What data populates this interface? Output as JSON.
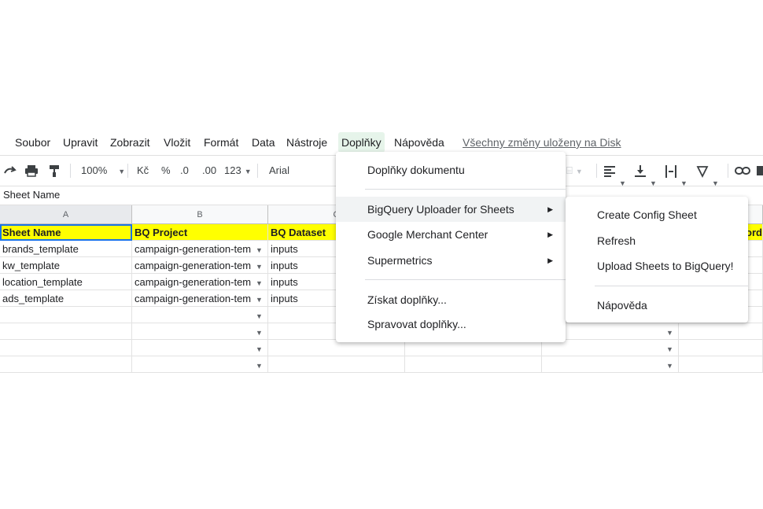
{
  "menubar": {
    "items": [
      "Soubor",
      "Upravit",
      "Zobrazit",
      "Vložit",
      "Formát",
      "Data",
      "Nástroje",
      "Doplňky",
      "Nápověda"
    ],
    "save_status": "Všechny změny uloženy na Disk"
  },
  "toolbar": {
    "zoom": "100%",
    "currency": "Kč",
    "percent": "%",
    "decrease_decimal": ".0",
    "increase_decimal": ".00",
    "number_format": "123",
    "font": "Arial"
  },
  "formula_bar": {
    "value": "Sheet Name"
  },
  "grid": {
    "columns": [
      "A",
      "B",
      "C"
    ],
    "header_row": [
      "Sheet Name",
      "BQ Project",
      "BQ Dataset",
      "ord"
    ],
    "rows": [
      [
        "brands_template",
        "campaign-generation-tem",
        "inputs"
      ],
      [
        "kw_template",
        "campaign-generation-tem",
        "inputs"
      ],
      [
        "location_template",
        "campaign-generation-tem",
        "inputs"
      ],
      [
        "ads_template",
        "campaign-generation-tem",
        "inputs"
      ]
    ]
  },
  "addons_menu": {
    "items": [
      "Doplňky dokumentu",
      "BigQuery Uploader for Sheets",
      "Google Merchant Center",
      "Supermetrics",
      "Získat doplňky...",
      "Spravovat doplňky..."
    ]
  },
  "submenu": {
    "items": [
      "Create Config Sheet",
      "Refresh",
      "Upload Sheets to BigQuery!",
      "Nápověda"
    ]
  },
  "colors": {
    "header_fill": "#ffff00",
    "active_menu": "#e6f4ea",
    "selection": "#1a73e8"
  }
}
